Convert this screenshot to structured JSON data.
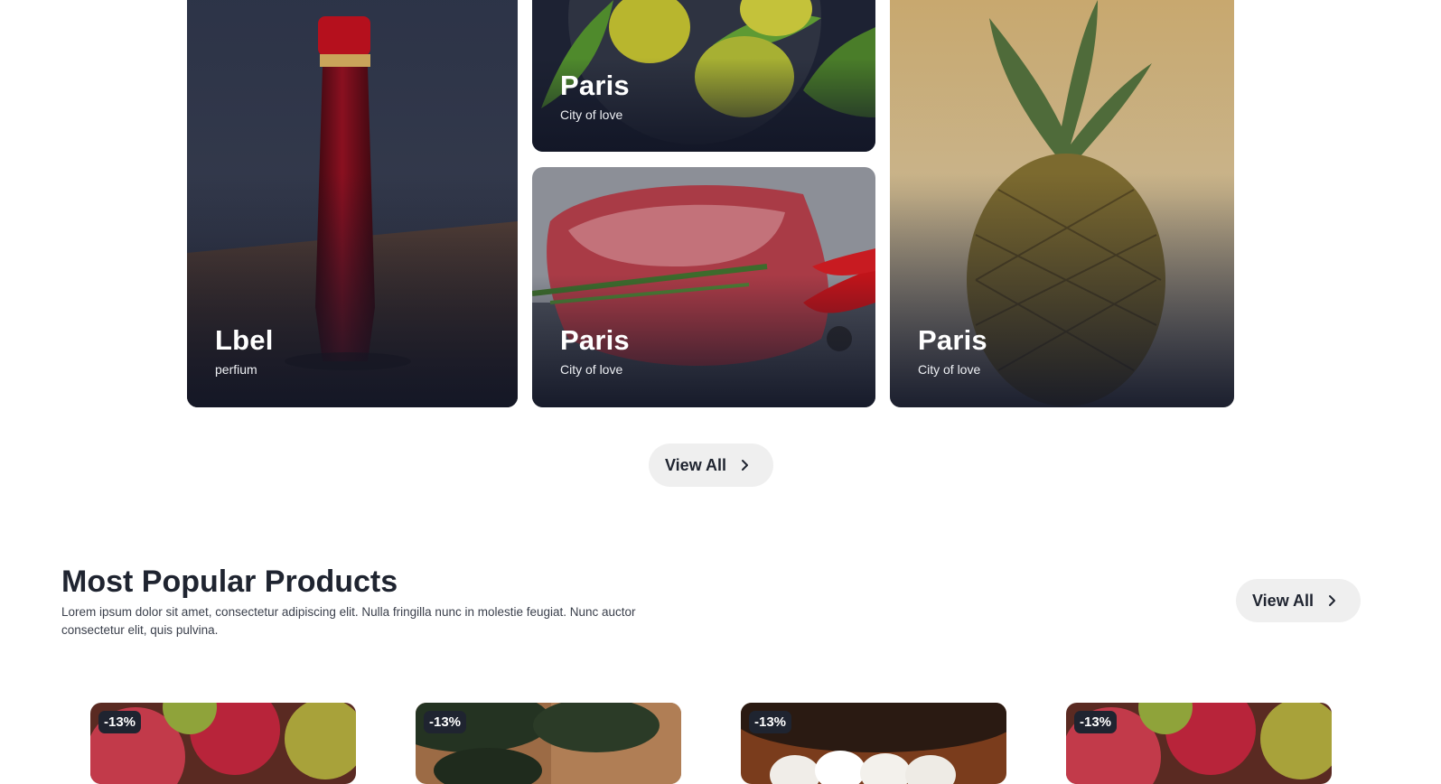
{
  "collections": [
    {
      "title": "Lbel",
      "subtitle": "perfium",
      "image": "perfume-bottle"
    },
    {
      "title": "Paris",
      "subtitle": "City of love",
      "image": "lemons-on-plate"
    },
    {
      "title": "Paris",
      "subtitle": "City of love",
      "image": "raw-steak-with-rosemary"
    },
    {
      "title": "Paris",
      "subtitle": "City of love",
      "image": "pineapple"
    }
  ],
  "collections_view_all": {
    "label": "View All",
    "icon": "chevron-right-icon"
  },
  "popular": {
    "title": "Most Popular Products",
    "description": "Lorem ipsum dolor sit amet, consectetur adipiscing elit. Nulla fringilla nunc in molestie feugiat. Nunc auctor consectetur elit, quis pulvina.",
    "view_all": "View All",
    "products": [
      {
        "badge": "-13%",
        "image": "apples"
      },
      {
        "badge": "-13%",
        "image": "avocados"
      },
      {
        "badge": "-13%",
        "image": "eggs"
      },
      {
        "badge": "-13%",
        "image": "apples"
      }
    ]
  },
  "colors": {
    "text": "#1f2430",
    "pill_bg": "#efefef",
    "badge_bg": "#1f2430"
  }
}
